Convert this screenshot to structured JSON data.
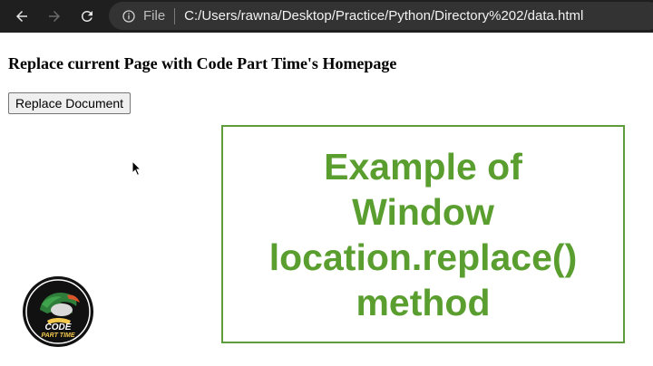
{
  "browser": {
    "back_icon": "arrow-left-icon",
    "forward_icon": "arrow-right-icon",
    "reload_icon": "reload-icon",
    "scheme_label": "File",
    "url": "C:/Users/rawna/Desktop/Practice/Python/Directory%202/data.html"
  },
  "page": {
    "heading": "Replace current Page with Code Part Time's Homepage",
    "button_label": "Replace Document"
  },
  "title_card": {
    "lines": [
      "Example of",
      "Window",
      "location.replace()",
      "method"
    ],
    "color": "#5a9e2f"
  },
  "logo": {
    "line1": "CODE",
    "line2": "PART TIME"
  }
}
